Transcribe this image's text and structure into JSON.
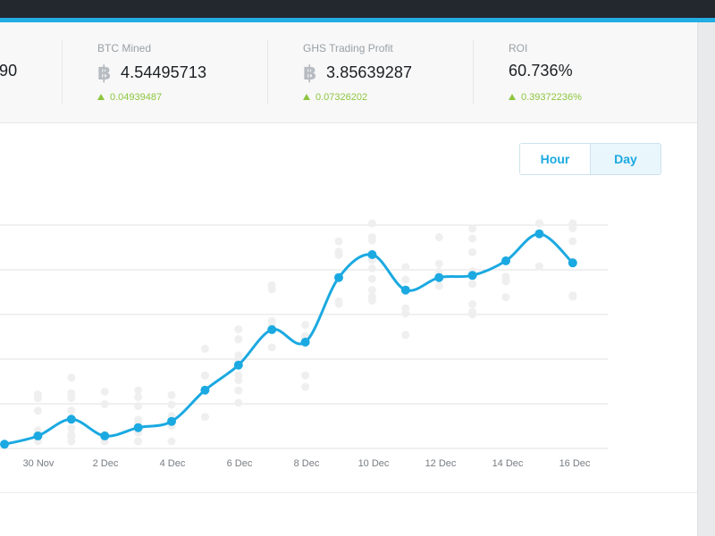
{
  "stats": [
    {
      "label": "",
      "value": "90",
      "delta": ""
    },
    {
      "label": "BTC Mined",
      "value": "4.54495713",
      "delta": "0.04939487",
      "icon": "bitcoin-icon"
    },
    {
      "label": "GHS Trading Profit",
      "value": "3.85639287",
      "delta": "0.07326202",
      "icon": "bitcoin-icon"
    },
    {
      "label": "ROI",
      "value": "60.736%",
      "delta": "0.39372236%"
    }
  ],
  "colors": {
    "accent": "#22ade4",
    "line": "#1ba9e1",
    "positive": "#8dc63f",
    "dots": "#efefef"
  },
  "toggle": {
    "hour_label": "Hour",
    "day_label": "Day",
    "selected": "Day"
  },
  "chart_data": {
    "type": "line",
    "x_labels": [
      "30 Nov",
      "2 Dec",
      "4 Dec",
      "6 Dec",
      "8 Dec",
      "10 Dec",
      "12 Dec",
      "14 Dec",
      "16 Dec"
    ],
    "grid": true,
    "series": [
      {
        "values": [
          0.2,
          0.6,
          1.4,
          0.6,
          1.0,
          1.3,
          2.8,
          4.0,
          5.7,
          5.1,
          8.2,
          9.3,
          7.6,
          8.2,
          8.3,
          9.0,
          10.3,
          8.9
        ]
      }
    ],
    "ylim": [
      0,
      10.8
    ]
  }
}
